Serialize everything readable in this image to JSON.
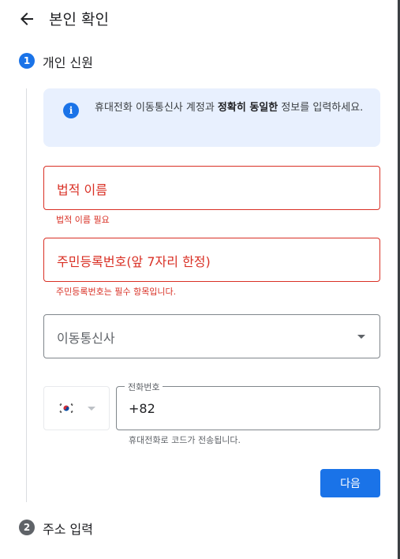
{
  "header": {
    "title": "본인 확인",
    "back_icon": "arrow-left-icon"
  },
  "steps": [
    {
      "number": "1",
      "label": "개인 신원",
      "status": "active",
      "color": "#1a73e8"
    },
    {
      "number": "2",
      "label": "주소 입력",
      "status": "inactive",
      "color": "#5f6368"
    }
  ],
  "info": {
    "icon": "info-icon",
    "text_before": "휴대전화 이동통신사 계정과 ",
    "text_bold": "정확히 동일한",
    "text_after": " 정보를 입력하세요."
  },
  "form": {
    "name": {
      "placeholder": "법적 이름",
      "error": "법적 이름 필요"
    },
    "ssn": {
      "placeholder": "주민등록번호(앞 7자리 한정)",
      "error": "주민등록번호는 필수 항목입니다."
    },
    "carrier": {
      "placeholder": "이동통신사"
    },
    "country": {
      "flag_icon": "korea-flag-icon"
    },
    "phone": {
      "label": "전화번호",
      "value": "+82",
      "hint": "휴대전화로 코드가 전송됩니다."
    }
  },
  "actions": {
    "next_label": "다음"
  },
  "colors": {
    "primary": "#1a73e8",
    "error": "#d93025",
    "info_bg": "#e8f0fe"
  }
}
